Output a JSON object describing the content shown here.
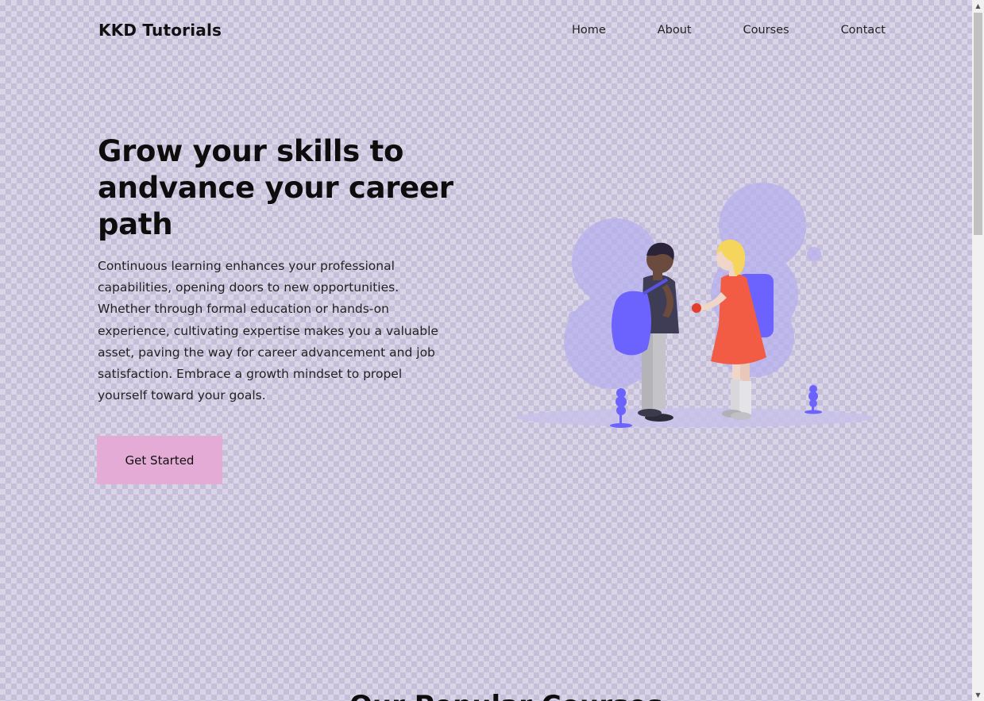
{
  "header": {
    "logo": "KKD Tutorials",
    "nav": [
      {
        "label": "Home"
      },
      {
        "label": "About"
      },
      {
        "label": "Courses"
      },
      {
        "label": "Contact"
      }
    ]
  },
  "hero": {
    "title": "Grow your skills to andvance your career path",
    "paragraph": "Continuous learning enhances your professional capabilities, opening doors to new opportunities. Whether through formal education or hands-on experience, cultivating expertise makes you a valuable asset, paving the way for career advancement and job satisfaction. Embrace a growth mindset to propel yourself toward your goals.",
    "cta_label": "Get Started",
    "illustration": "students-with-backpacks-illustration"
  },
  "next_section": {
    "title_partial": "Our Popular Courses"
  },
  "colors": {
    "background": "#d9d4e6",
    "pattern": "#c6bfd9",
    "cta": "#e3abd6",
    "accent_purple": "#6c63ff",
    "accent_red": "#f25c45"
  },
  "icons": {
    "scroll_up": "triangle-up-icon",
    "scroll_down": "triangle-down-icon"
  }
}
